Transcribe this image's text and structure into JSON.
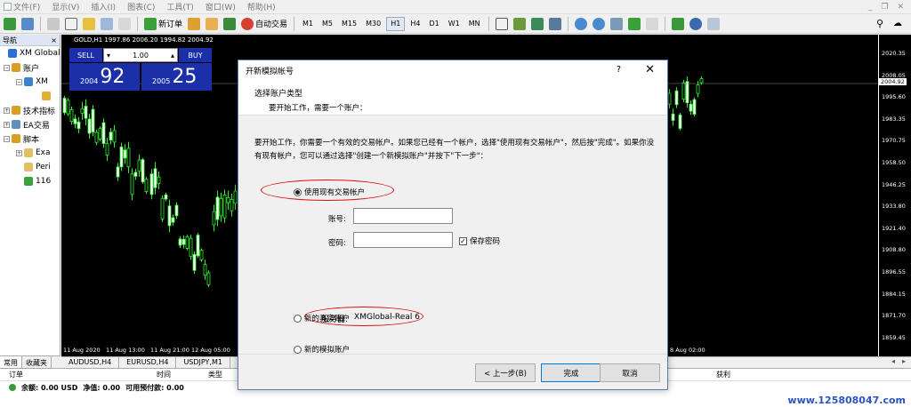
{
  "menu": {
    "items": [
      "文件(F)",
      "显示(V)",
      "插入(I)",
      "图表(C)",
      "工具(T)",
      "窗口(W)",
      "帮助(H)"
    ],
    "window_controls": [
      "_",
      "❐",
      "✕"
    ]
  },
  "toolbar": {
    "new_order": "新订单",
    "auto_trade": "自动交易",
    "timeframes": [
      "M1",
      "M5",
      "M15",
      "M30",
      "H1",
      "H4",
      "D1",
      "W1",
      "MN"
    ],
    "active_timeframe": "H1"
  },
  "navigator": {
    "title": "导航",
    "close": "×",
    "rows": [
      {
        "indent": 0,
        "text": "XM Global",
        "icon": "terminal-icon",
        "color": "#2a6fd6",
        "exp": ""
      },
      {
        "indent": 4,
        "text": "账户",
        "icon": "accounts-icon",
        "color": "#d8a020",
        "exp": "−"
      },
      {
        "indent": 18,
        "text": "XM",
        "icon": "server-icon",
        "color": "#3b82d0",
        "exp": "−"
      },
      {
        "indent": 38,
        "text": "",
        "icon": "user-icon",
        "color": "#e0b030",
        "exp": ""
      },
      {
        "indent": 4,
        "text": "技术指标",
        "icon": "indicators-icon",
        "color": "#d8a020",
        "exp": "+"
      },
      {
        "indent": 4,
        "text": "EA交易",
        "icon": "expert-advisors-icon",
        "color": "#6090c0",
        "exp": "+"
      },
      {
        "indent": 4,
        "text": "脚本",
        "icon": "scripts-icon",
        "color": "#d8a020",
        "exp": "−"
      },
      {
        "indent": 18,
        "text": "Exa",
        "icon": "folder-icon",
        "color": "#e0c060",
        "exp": "+"
      },
      {
        "indent": 18,
        "text": "Peri",
        "icon": "script-icon",
        "color": "#e0c060",
        "exp": ""
      },
      {
        "indent": 18,
        "text": "116",
        "icon": "script-icon",
        "color": "#3aa040",
        "exp": ""
      }
    ],
    "tabs": [
      "常用",
      "收藏夹"
    ]
  },
  "chart": {
    "header": "GOLD,H1  1997.86 2006.20 1994.82 2004.92",
    "current_price": "2004.92",
    "y_ticks": [
      "2020.35",
      "2008.05",
      "1995.60",
      "1983.35",
      "1970.75",
      "1958.50",
      "1946.25",
      "1933.80",
      "1921.40",
      "1908.80",
      "1896.55",
      "1884.15",
      "1871.70",
      "1859.45"
    ],
    "x_ticks": [
      "11 Aug 2020",
      "11 Aug 13:00",
      "11 Aug 21:00",
      "12 Aug 05:00",
      "8 Aug 02:00"
    ]
  },
  "trade_panel": {
    "sell_label": "SELL",
    "buy_label": "BUY",
    "lot": "1.00",
    "sell_small": "2004",
    "sell_big": "92",
    "buy_small": "2005",
    "buy_big": "25"
  },
  "symbol_tabs": [
    "AUDUSD,H4",
    "EURUSD,H4",
    "USDJPY,M1"
  ],
  "terminal": {
    "columns": [
      "订单",
      "时间",
      "类型",
      "获利"
    ],
    "summary": [
      "余额: 0.00 USD",
      "净值: 0.00",
      "可用预付款: 0.00"
    ],
    "watermark": "www.125808047.com"
  },
  "dialog": {
    "title": "开新模拟帐号",
    "help": "?",
    "close": "✕",
    "heading": "选择账户类型",
    "subheading": "要开始工作，需要一个账户：",
    "intro": "要开始工作，你需要一个有效的交易帐户。如果您已经有一个帐户，选择\"使用现有交易帐户\"，然后按\"完成\"。如果你没有现有帐户，您可以通过选择\"创建一个新模拟账户\"并按下\"下一步\"：",
    "option_existing": "使用现有交易帐户",
    "login_label": "账号:",
    "password_label": "密码:",
    "login_value": "",
    "password_value": "",
    "save_password": "保存密码",
    "save_password_checked": "✓",
    "server_label": "服务器:",
    "server_value": "XMGlobal-Real 6",
    "option_demo": "新的模拟账户",
    "option_real": "新的真实账户",
    "back_button": "< 上一步(B)",
    "finish_button": "完成",
    "cancel_button": "取消"
  }
}
